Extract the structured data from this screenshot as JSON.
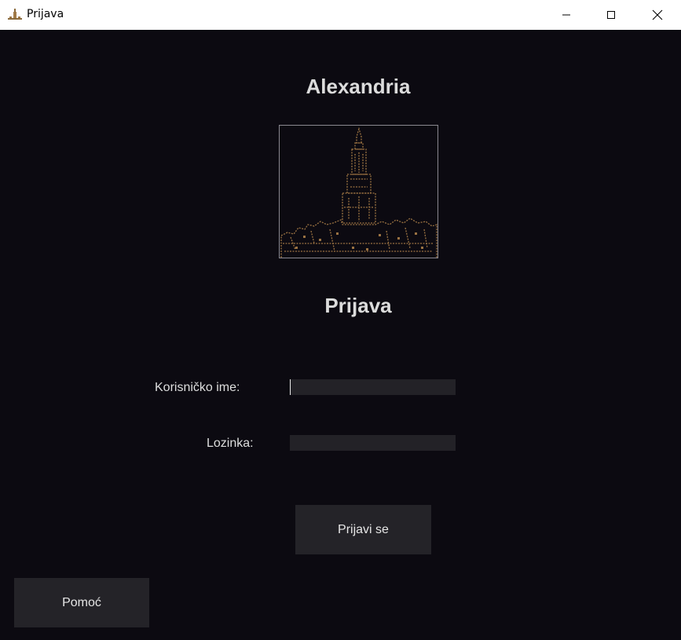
{
  "window": {
    "title": "Prijava",
    "icon": "tower-icon",
    "controls": [
      "minimize-icon",
      "maximize-icon",
      "close-icon"
    ]
  },
  "app": {
    "name": "Alexandria",
    "logo": "cathedral-tower-logo"
  },
  "login": {
    "title": "Prijava",
    "username_label": "Korisničko ime:",
    "username_value": "",
    "password_label": "Lozinka:",
    "password_value": "",
    "submit_label": "Prijavi se"
  },
  "help": {
    "label": "Pomoć"
  },
  "colors": {
    "background": "#0c0a11",
    "field": "#232227",
    "button": "#242328",
    "logo": "#9a7242",
    "text": "#dcdcdc"
  }
}
